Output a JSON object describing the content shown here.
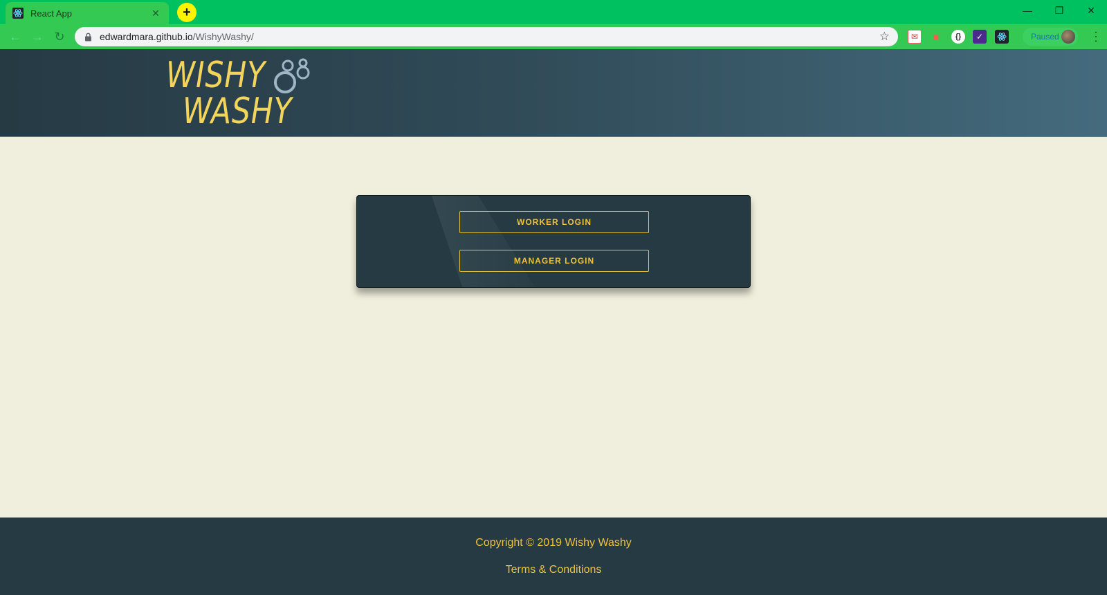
{
  "browser": {
    "tab_title": "React App",
    "url_host": "edwardmara.github.io",
    "url_path": "/WishyWashy/",
    "profile_status": "Paused"
  },
  "site": {
    "logo_line1": "WISHY",
    "logo_line2": "WASHY",
    "brand_color": "#f0c23a",
    "header_color": "#263a44"
  },
  "login": {
    "worker_label": "WORKER LOGIN",
    "manager_label": "MANAGER LOGIN"
  },
  "footer": {
    "copyright": "Copyright © 2019 Wishy Washy",
    "terms": "Terms & Conditions"
  }
}
